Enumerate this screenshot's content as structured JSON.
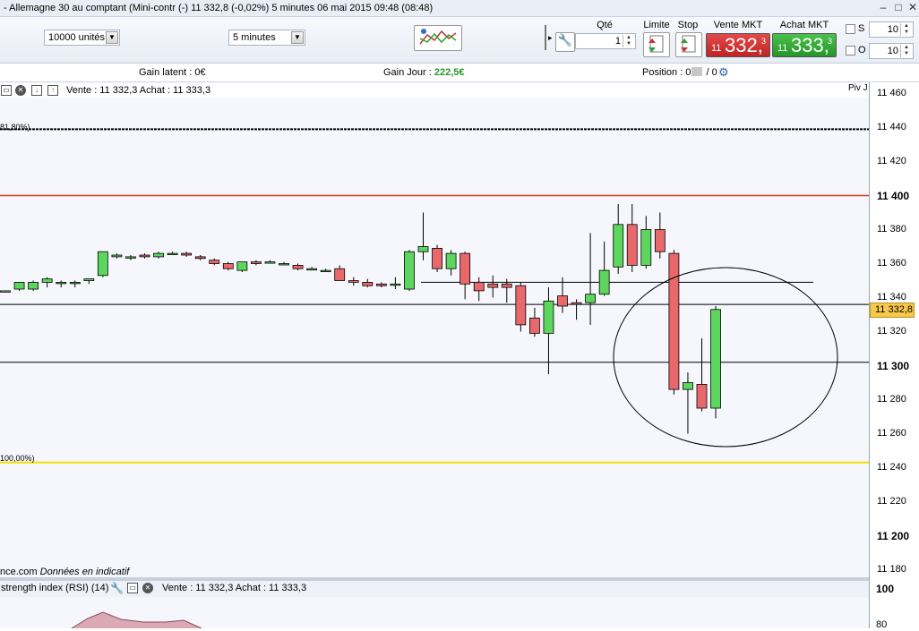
{
  "window": {
    "title": "- Allemagne 30 au comptant (Mini-contr (-)   11 332,8 (-0,02%)   5 minutes  06 mai 2015 09:48 (08:48)"
  },
  "toolbar": {
    "quantity_select": "10000 unités",
    "period_select": "5 minutes",
    "qty_header": "Qté",
    "limit_header": "Limite",
    "stop_header": "Stop",
    "sell_header": "Vente MKT",
    "buy_header": "Achat MKT",
    "qty_value": "1",
    "sell_price": {
      "small": "11",
      "big": "332,",
      "sup": "3"
    },
    "buy_price": {
      "small": "11",
      "big": "333,",
      "sup": "3"
    },
    "s_label": "S",
    "o_label": "O",
    "s_value": "10",
    "o_value": "10"
  },
  "info": {
    "gain_latent": "Gain latent : 0€",
    "gain_jour_label": "Gain Jour : ",
    "gain_jour_value": "222,5€",
    "position_label": "Position : 0",
    "position_sep": " / 0"
  },
  "chart": {
    "header_text": "Vente : 11 332,3  Achat : 11 333,3",
    "fib_top": "81,80%)",
    "fib_bottom": "100,00%)",
    "piv_label": "Piv J",
    "source": "nce.com",
    "source_note": "Données en indicatif",
    "current_price": "11 332,8",
    "colors": {
      "up": "#5cd65c",
      "down": "#e8686c",
      "resistance": "#e03020",
      "support_fib": "#f0e000",
      "price_tag": "#f7c84a"
    }
  },
  "yaxis": {
    "labels": [
      {
        "text": "11 460",
        "bold": false
      },
      {
        "text": "11 440",
        "bold": false
      },
      {
        "text": "11 420",
        "bold": false
      },
      {
        "text": "11 400",
        "bold": true
      },
      {
        "text": "11 380",
        "bold": false
      },
      {
        "text": "11 360",
        "bold": false
      },
      {
        "text": "11 340",
        "bold": false
      },
      {
        "text": "11 320",
        "bold": false
      },
      {
        "text": "11 300",
        "bold": true
      },
      {
        "text": "11 280",
        "bold": false
      },
      {
        "text": "11 260",
        "bold": false
      },
      {
        "text": "11 240",
        "bold": false
      },
      {
        "text": "11 220",
        "bold": false
      },
      {
        "text": "11 200",
        "bold": true
      },
      {
        "text": "11 180",
        "bold": false
      }
    ]
  },
  "rsi": {
    "title": "strength index (RSI) (14)",
    "quote": "Vente : 11 332,3  Achat : 11 333,3",
    "axis_100": "100",
    "axis_80": "80"
  },
  "chart_data": {
    "type": "candlestick",
    "y_unit": "points",
    "ylim": [
      11173,
      11472
    ],
    "price_scale": [
      11180,
      11460
    ],
    "candles": [
      {
        "o": 11344,
        "h": 11344,
        "l": 11344,
        "c": 11344
      },
      {
        "o": 11345,
        "h": 11348,
        "l": 11344,
        "c": 11349
      },
      {
        "o": 11345,
        "h": 11350,
        "l": 11344,
        "c": 11349
      },
      {
        "o": 11349,
        "h": 11352,
        "l": 11346,
        "c": 11351
      },
      {
        "o": 11349,
        "h": 11350,
        "l": 11346,
        "c": 11349
      },
      {
        "o": 11349,
        "h": 11350,
        "l": 11346,
        "c": 11349
      },
      {
        "o": 11350,
        "h": 11351,
        "l": 11348,
        "c": 11351
      },
      {
        "o": 11353,
        "h": 11367,
        "l": 11352,
        "c": 11367
      },
      {
        "o": 11364,
        "h": 11366,
        "l": 11363,
        "c": 11365
      },
      {
        "o": 11364,
        "h": 11365,
        "l": 11362,
        "c": 11364
      },
      {
        "o": 11365,
        "h": 11366,
        "l": 11363,
        "c": 11364
      },
      {
        "o": 11364,
        "h": 11367,
        "l": 11363,
        "c": 11366
      },
      {
        "o": 11366,
        "h": 11367,
        "l": 11365,
        "c": 11366
      },
      {
        "o": 11366,
        "h": 11367,
        "l": 11364,
        "c": 11365
      },
      {
        "o": 11364,
        "h": 11365,
        "l": 11362,
        "c": 11363
      },
      {
        "o": 11362,
        "h": 11363,
        "l": 11359,
        "c": 11360
      },
      {
        "o": 11360,
        "h": 11361,
        "l": 11356,
        "c": 11357
      },
      {
        "o": 11356,
        "h": 11361,
        "l": 11355,
        "c": 11361
      },
      {
        "o": 11361,
        "h": 11362,
        "l": 11359,
        "c": 11360
      },
      {
        "o": 11361,
        "h": 11362,
        "l": 11360,
        "c": 11361
      },
      {
        "o": 11360,
        "h": 11361,
        "l": 11359,
        "c": 11360
      },
      {
        "o": 11359,
        "h": 11360,
        "l": 11356,
        "c": 11357
      },
      {
        "o": 11357,
        "h": 11358,
        "l": 11356,
        "c": 11357
      },
      {
        "o": 11356,
        "h": 11357,
        "l": 11355,
        "c": 11356
      },
      {
        "o": 11357,
        "h": 11359,
        "l": 11350,
        "c": 11350
      },
      {
        "o": 11350,
        "h": 11352,
        "l": 11347,
        "c": 11349
      },
      {
        "o": 11349,
        "h": 11351,
        "l": 11346,
        "c": 11347
      },
      {
        "o": 11348,
        "h": 11349,
        "l": 11346,
        "c": 11347
      },
      {
        "o": 11348,
        "h": 11352,
        "l": 11345,
        "c": 11348
      },
      {
        "o": 11345,
        "h": 11368,
        "l": 11344,
        "c": 11367
      },
      {
        "o": 11367,
        "h": 11390,
        "l": 11362,
        "c": 11370
      },
      {
        "o": 11369,
        "h": 11371,
        "l": 11355,
        "c": 11357
      },
      {
        "o": 11357,
        "h": 11368,
        "l": 11353,
        "c": 11366
      },
      {
        "o": 11366,
        "h": 11367,
        "l": 11339,
        "c": 11348
      },
      {
        "o": 11349,
        "h": 11352,
        "l": 11338,
        "c": 11344
      },
      {
        "o": 11348,
        "h": 11353,
        "l": 11340,
        "c": 11346
      },
      {
        "o": 11348,
        "h": 11351,
        "l": 11337,
        "c": 11346
      },
      {
        "o": 11347,
        "h": 11349,
        "l": 11320,
        "c": 11324
      },
      {
        "o": 11328,
        "h": 11334,
        "l": 11317,
        "c": 11319
      },
      {
        "o": 11319,
        "h": 11346,
        "l": 11295,
        "c": 11338
      },
      {
        "o": 11341,
        "h": 11352,
        "l": 11331,
        "c": 11335
      },
      {
        "o": 11337,
        "h": 11339,
        "l": 11327,
        "c": 11336
      },
      {
        "o": 11337,
        "h": 11378,
        "l": 11324,
        "c": 11342
      },
      {
        "o": 11342,
        "h": 11373,
        "l": 11341,
        "c": 11356
      },
      {
        "o": 11358,
        "h": 11395,
        "l": 11354,
        "c": 11383
      },
      {
        "o": 11383,
        "h": 11395,
        "l": 11355,
        "c": 11359
      },
      {
        "o": 11359,
        "h": 11388,
        "l": 11357,
        "c": 11380
      },
      {
        "o": 11380,
        "h": 11390,
        "l": 11363,
        "c": 11367
      },
      {
        "o": 11366,
        "h": 11368,
        "l": 11283,
        "c": 11286
      },
      {
        "o": 11286,
        "h": 11296,
        "l": 11260,
        "c": 11290
      },
      {
        "o": 11289,
        "h": 11316,
        "l": 11273,
        "c": 11275
      },
      {
        "o": 11275,
        "h": 11335,
        "l": 11269,
        "c": 11333
      }
    ],
    "levels": [
      11458,
      11439,
      11400,
      11349,
      11336,
      11302,
      11243
    ]
  }
}
